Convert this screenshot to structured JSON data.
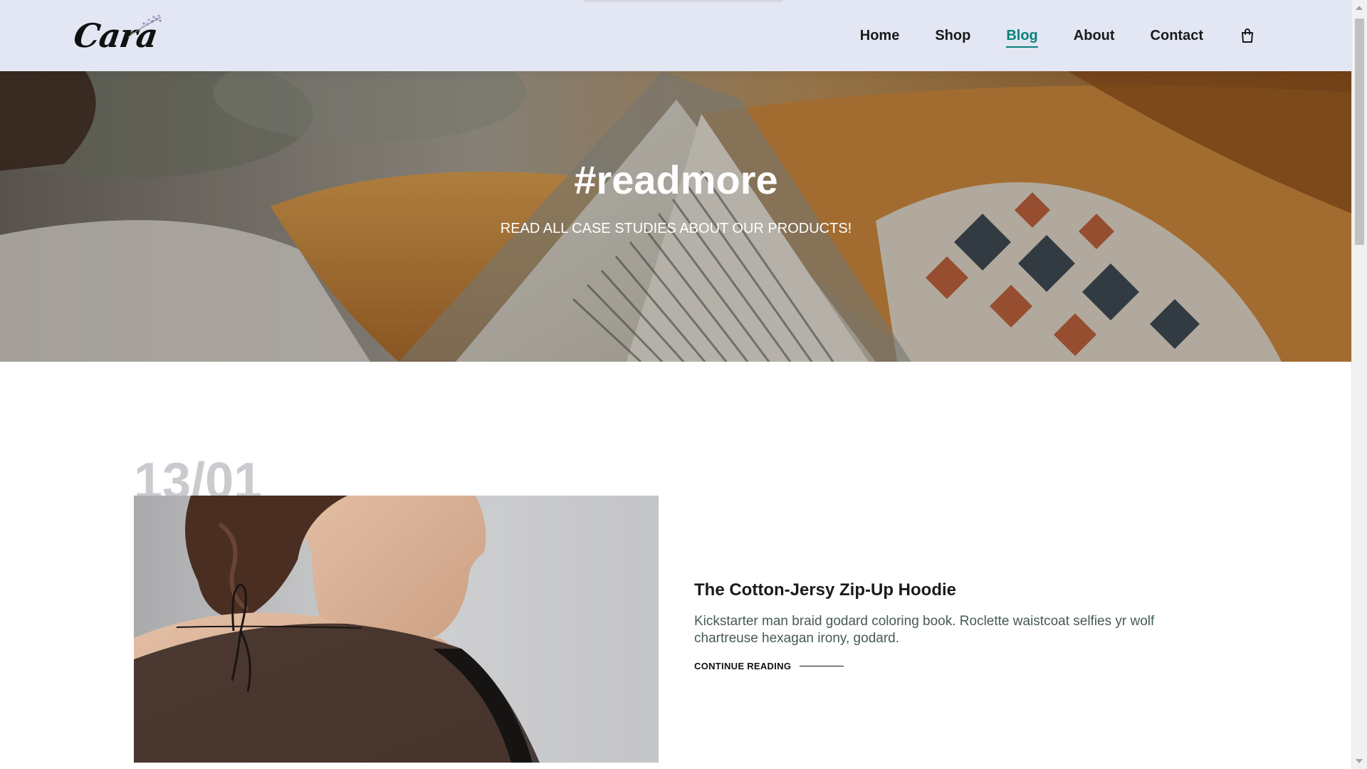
{
  "header": {
    "logo_text": "Cara",
    "nav": [
      {
        "label": "Home"
      },
      {
        "label": "Shop"
      },
      {
        "label": "Blog",
        "active": true
      },
      {
        "label": "About"
      },
      {
        "label": "Contact"
      }
    ],
    "cart_icon": "shopping-bag-icon"
  },
  "hero": {
    "title": "#readmore",
    "subtitle": "READ ALL CASE STUDIES ABOUT OUR PRODUCTS!"
  },
  "blog": {
    "posts": [
      {
        "date": "13/01",
        "title": "The Cotton-Jersy Zip-Up Hoodie",
        "text": "Kickstarter man braid godard coloring book. Roclette waistcoat selfies yr wolf chartreuse hexagan irony, godard.",
        "link_label": "CONTINUE READING"
      }
    ]
  },
  "colors": {
    "header_bg": "#e3e6f3",
    "accent": "#088178",
    "date_gray": "#c9cbce",
    "body_text": "#465b52"
  }
}
